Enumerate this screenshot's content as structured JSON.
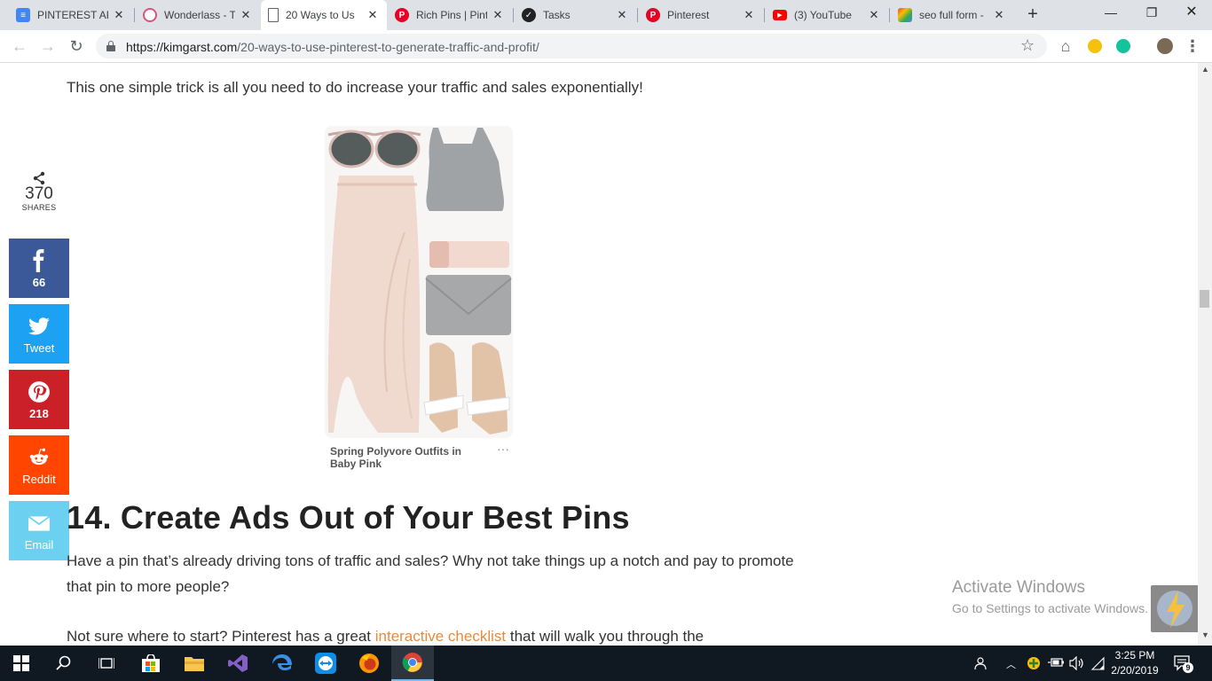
{
  "browser": {
    "tabs": [
      {
        "title": "PINTEREST AR",
        "icon": "docs-icon",
        "color": "#4285f4",
        "active": false
      },
      {
        "title": "Wonderlass - T",
        "icon": "wonderlass-icon",
        "color": "#d9547a",
        "active": false
      },
      {
        "title": "20 Ways to Us",
        "icon": "page-icon",
        "color": "#5f6368",
        "active": true
      },
      {
        "title": "Rich Pins | Pint",
        "icon": "pinterest-icon",
        "color": "#e60023",
        "active": false
      },
      {
        "title": "Tasks",
        "icon": "tasks-icon",
        "color": "#222222",
        "active": false
      },
      {
        "title": "Pinterest",
        "icon": "pinterest-icon",
        "color": "#e60023",
        "active": false
      },
      {
        "title": "(3) YouTube",
        "icon": "youtube-icon",
        "color": "#ff0000",
        "active": false
      },
      {
        "title": "seo full form -",
        "icon": "google-icon",
        "color": "#222222",
        "active": false
      }
    ],
    "url_domain": "https://kimgarst.com",
    "url_path": "/20-ways-to-use-pinterest-to-generate-traffic-and-profit/"
  },
  "page": {
    "lead": "This one simple trick is all you need to do increase your traffic and sales exponentially!",
    "pin": {
      "title": "Spring Polyvore Outfits in Baby Pink",
      "more": "···"
    },
    "heading": "14. Create Ads Out of Your Best Pins",
    "para1": "Have a pin that’s already driving tons of traffic and sales? Why not take things up a notch and pay to promote that pin to more people?",
    "para2_prefix": "Not sure where to start? Pinterest has a great ",
    "para2_link": "interactive checklist",
    "para2_suffix": " that will walk you through the"
  },
  "share": {
    "total": "370",
    "total_label": "SHARES",
    "buttons": [
      {
        "network": "facebook",
        "label": "66",
        "color": "#3b5998"
      },
      {
        "network": "twitter",
        "label": "Tweet",
        "color": "#1da1f2"
      },
      {
        "network": "pinterest",
        "label": "218",
        "color": "#cb2027"
      },
      {
        "network": "reddit",
        "label": "Reddit",
        "color": "#ff4500"
      },
      {
        "network": "email",
        "label": "Email",
        "color": "#6cd0f0"
      }
    ]
  },
  "watermark": {
    "line1": "Activate Windows",
    "line2": "Go to Settings to activate Windows."
  },
  "taskbar": {
    "time": "3:25 PM",
    "date": "2/20/2019",
    "notification_count": "9"
  }
}
